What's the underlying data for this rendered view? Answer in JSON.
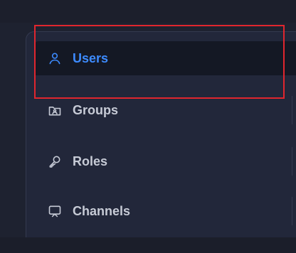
{
  "nav": {
    "items": [
      {
        "label": "Users",
        "icon": "user-icon",
        "active": true
      },
      {
        "label": "Groups",
        "icon": "groups-icon",
        "active": false
      },
      {
        "label": "Roles",
        "icon": "key-icon",
        "active": false
      },
      {
        "label": "Channels",
        "icon": "channels-icon",
        "active": false
      }
    ]
  },
  "colors": {
    "accent": "#3d8bff",
    "highlight_box": "#e0262e",
    "text": "#c7cbd6",
    "panel_bg": "#22273a",
    "active_bg": "#141824"
  }
}
